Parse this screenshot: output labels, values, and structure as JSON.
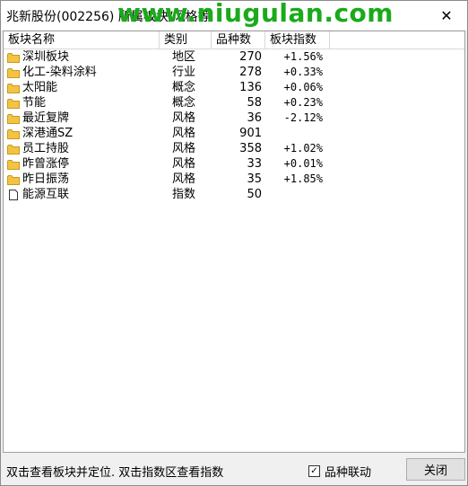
{
  "window": {
    "title": "兆新股份(002256) 所属板块/风格等",
    "watermark": "www.niugulan.com",
    "close_glyph": "✕"
  },
  "table": {
    "headers": [
      "板块名称",
      "类别",
      "品种数",
      "板块指数"
    ],
    "rows": [
      {
        "name": "深圳板块",
        "type": "地区",
        "count": "270",
        "index": "+1.56%",
        "icon": "folder-icon"
      },
      {
        "name": "化工-染料涂料",
        "type": "行业",
        "count": "278",
        "index": "+0.33%",
        "icon": "folder-icon"
      },
      {
        "name": "太阳能",
        "type": "概念",
        "count": "136",
        "index": "+0.06%",
        "icon": "folder-icon"
      },
      {
        "name": "节能",
        "type": "概念",
        "count": "58",
        "index": "+0.23%",
        "icon": "folder-icon"
      },
      {
        "name": "最近复牌",
        "type": "风格",
        "count": "36",
        "index": "-2.12%",
        "icon": "folder-icon"
      },
      {
        "name": "深港通SZ",
        "type": "风格",
        "count": "901",
        "index": "",
        "icon": "folder-icon"
      },
      {
        "name": "员工持股",
        "type": "风格",
        "count": "358",
        "index": "+1.02%",
        "icon": "folder-icon"
      },
      {
        "name": "昨曾涨停",
        "type": "风格",
        "count": "33",
        "index": "+0.01%",
        "icon": "folder-icon"
      },
      {
        "name": "昨日振荡",
        "type": "风格",
        "count": "35",
        "index": "+1.85%",
        "icon": "folder-icon"
      },
      {
        "name": "能源互联",
        "type": "指数",
        "count": "50",
        "index": "",
        "icon": "document-icon"
      }
    ]
  },
  "footer": {
    "hint": "双击查看板块并定位. 双击指数区查看指数",
    "checkbox_label": "品种联动",
    "checkbox_checked": true,
    "check_glyph": "✓",
    "close_button": "关闭"
  },
  "colors": {
    "folder": "#f3c343",
    "folder_edge": "#c89a1c",
    "watermark": "#1aaa1a"
  }
}
